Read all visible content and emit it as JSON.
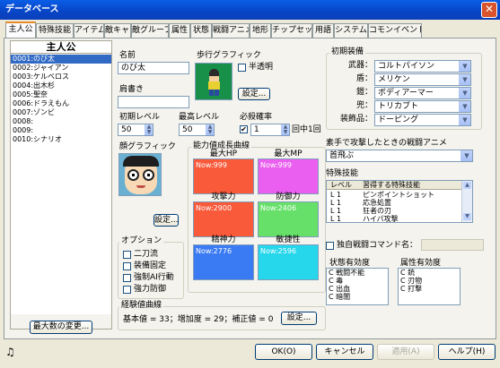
{
  "window": {
    "title": "データベース",
    "close": "✕"
  },
  "tabs": [
    "主人公",
    "特殊技能",
    "アイテム",
    "敵キャラ",
    "敵グループ",
    "属性",
    "状態",
    "戦闘アニメ",
    "地形",
    "チップセット",
    "用語",
    "システム",
    "コモンイベント"
  ],
  "char_list": {
    "header": "主人公",
    "items": [
      "0001:のび太",
      "0002:ジャイアン",
      "0003:ケルベロス",
      "0004:出木杉",
      "0005:聖奈",
      "0006:ドラえもん",
      "0007:ゾンビ",
      "0008:",
      "0009:",
      "0010:シナリオ"
    ],
    "max_btn": "最大数の変更..."
  },
  "name": {
    "label": "名前",
    "value": "のび太"
  },
  "walk": {
    "label": "歩行グラフィック",
    "translucent": "半透明",
    "set_btn": "設定..."
  },
  "title_f": {
    "label": "肩書き",
    "value": ""
  },
  "levels": {
    "init_label": "初期レベル",
    "init_value": "50",
    "max_label": "最高レベル",
    "max_value": "50",
    "crit_label": "必殺確率",
    "crit_value": "1",
    "crit_suffix": "回中1回"
  },
  "face": {
    "label": "顔グラフィック",
    "set_btn": "設定..."
  },
  "growth": {
    "label": "能力値成長曲線",
    "stats": [
      {
        "name": "最大HP",
        "value": "Now:999",
        "color": "#f85a3a"
      },
      {
        "name": "最大MP",
        "value": "Now:999",
        "color": "#ea5ff0"
      },
      {
        "name": "攻撃力",
        "value": "Now:2900",
        "color": "#f85a3a"
      },
      {
        "name": "防御力",
        "value": "Now:2406",
        "color": "#67e06a"
      },
      {
        "name": "精神力",
        "value": "Now:2776",
        "color": "#3a7af2"
      },
      {
        "name": "敏捷性",
        "value": "Now:2596",
        "color": "#26d7ec"
      }
    ]
  },
  "options": {
    "label": "オプション",
    "items": [
      "二刀流",
      "装備固定",
      "強制AI行動",
      "強力防御"
    ]
  },
  "exp": {
    "label": "経験値曲線",
    "value": "基本値 = 33；増加度 = 29；補正値 = 0",
    "set_btn": "設定..."
  },
  "equip": {
    "label": "初期装備",
    "rows": [
      {
        "name": "武器：",
        "value": "コルトパイソン"
      },
      {
        "name": "盾：",
        "value": "メリケン"
      },
      {
        "name": "鎧：",
        "value": "ボディアーマー"
      },
      {
        "name": "兜：",
        "value": "トリカブト"
      },
      {
        "name": "装飾品：",
        "value": "ドーピング"
      }
    ]
  },
  "unarmed": {
    "label": "素手で攻撃したときの戦闘アニメ",
    "value": "首飛ぶ"
  },
  "skills": {
    "label": "特殊技能",
    "col_level": "レベル",
    "col_skill": "習得する特殊技能",
    "rows": [
      {
        "level": "L 1",
        "skill": "ピンポイントショット"
      },
      {
        "level": "L 1",
        "skill": "応急処置"
      },
      {
        "level": "L 1",
        "skill": "狂者の刃"
      },
      {
        "level": "L 1",
        "skill": "ハイパ攻撃"
      }
    ]
  },
  "battle_cmd": {
    "label": "独自戦闘コマンド名："
  },
  "state_eff": {
    "label": "状態有効度",
    "items": [
      "C 戦闘不能",
      "C 毒",
      "C 出血",
      "C 暗闇"
    ]
  },
  "attr_eff": {
    "label": "属性有効度",
    "items": [
      "C 銃",
      "C 刃物",
      "C 打撃"
    ]
  },
  "footer": {
    "ok": "OK(O)",
    "cancel": "キャンセル",
    "apply": "適用(A)",
    "help": "ヘルプ(H)"
  }
}
